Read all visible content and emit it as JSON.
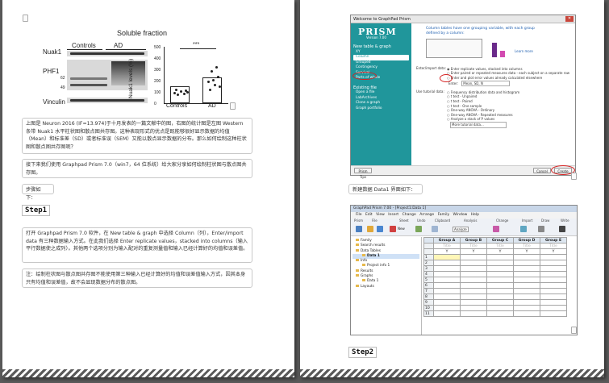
{
  "left_page": {
    "figure": {
      "title": "Soluble fraction",
      "group_controls": "Controls",
      "group_ad": "AD",
      "row_nuak1": "Nuak1",
      "row_phf1": "PHF1",
      "row_vinculin": "Vinculin",
      "mw_62": "62",
      "mw_49": "49",
      "significance": "***",
      "y_axis_label": "Nuak1 levels (%)",
      "y_ticks": [
        "500",
        "400",
        "300",
        "200",
        "100",
        "0"
      ],
      "x_labels": [
        "Controls",
        "AD"
      ]
    },
    "para1": "上图是 Neuron 2016 (IF=13.974)于十月发表的一篇文献中的图，右图的统计图是左图 Western 条带 Nuak1 水平柱状图和散点图共存图。这种表现形式的优点是既能够很好显示数据的均值（Mean）和标准差（SD）或者标准误（SEM）又能以散点显示数据的分布。那么如何绘制这种柱状图和散点图共存图呢？",
    "para2": "接下来我们使用 Graphpad Prism 7.0（win7，64 位系统）给大家分享如何绘制柱状图与散点图共存图。",
    "para3": "步骤如下：",
    "step1": "Step1",
    "para4": "打开 Graphpad Prism 7.0 软件，在 New table & graph 中选择 Column（列），Enter/import data 有三种数据输入方式。在此我们选择 Enter replicate values，stacked into columns（输入平行数据使之成列）。其他两个选项分别为输入配对的重复测量值和输入已经计算好的均值和误差值。",
    "para5": "注：绘制柱状图与散点图共存图不能使用第三种输入已经计算好的均值和误差值输入方式，因其本身只有均值和误差值，故不会显现数据分布的散点图。"
  },
  "right_page": {
    "dialog": {
      "title": "Welcome to GraphPad Prism",
      "logo": "PRISM",
      "version": "Version 7.00",
      "sidebar_heading": "New table & graph",
      "sidebar_items": [
        "XY",
        "Column",
        "Grouped",
        "Contingency",
        "Survival",
        "Parts of whole"
      ],
      "existing_heading": "Existing file",
      "existing_items": [
        "Open a file",
        "LabArchives",
        "Clone a graph",
        "Graph portfolio"
      ],
      "heading": "Column tables have one grouping variable, with each group defined by a column:",
      "learn_more": "Learn more",
      "data_label": "Enter/import data:",
      "options": [
        "Enter replicate values, stacked into columns",
        "Enter paired or repeated measures data - each subject on a separate row",
        "Enter and plot error values already calculated elsewhere"
      ],
      "enter_label": "Enter:",
      "enter_value": "Mean, SD, N",
      "tutorial_label": "Use tutorial data:",
      "tutorials": [
        "Frequency distribution data and histogram",
        "t test - Unpaired",
        "t test - Paired",
        "t test - One sample",
        "One-way ANOVA - Ordinary",
        "One-way ANOVA - Repeated measures",
        "Analyze a stack of P values"
      ],
      "tutorial_select": "More tutorial data...",
      "prism_tips": "Prism Tips",
      "cancel": "Cancel",
      "create": "Create"
    },
    "caption": "新建数据 Data1 界面如下：",
    "app": {
      "title": "GraphPad Prism 7.00 - [Project1:Data 1]",
      "menu": [
        "File",
        "Edit",
        "View",
        "Insert",
        "Change",
        "Arrange",
        "Family",
        "Window",
        "Help"
      ],
      "toolbar_groups": [
        "Prism",
        "File",
        "Sheet",
        "Undo",
        "Clipboard",
        "Analysis",
        "Change",
        "Import",
        "Draw",
        "Write"
      ],
      "analyze": "Analyze",
      "new": "New",
      "nav": [
        "Family",
        "Search results",
        "Data Tables",
        "Data 1",
        "Info",
        "Project info 1",
        "Results",
        "Graphs",
        "Data 1",
        "Layouts"
      ],
      "columns": [
        "Group A",
        "Group B",
        "Group C",
        "Group D",
        "Group E"
      ],
      "title_row": [
        "Title",
        "Title",
        "Title",
        "Title",
        "Title"
      ],
      "y_row": [
        "Y",
        "Y",
        "Y",
        "Y",
        "Y"
      ],
      "rows": [
        "1",
        "2",
        "3",
        "4",
        "5",
        "6",
        "7",
        "8",
        "9",
        "10",
        "11"
      ]
    },
    "step2": "Step2"
  }
}
